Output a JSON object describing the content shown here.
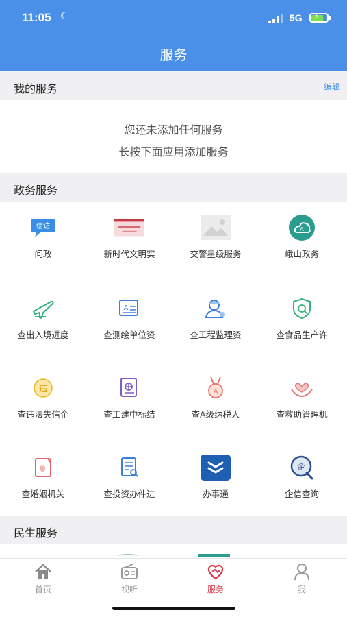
{
  "status_bar": {
    "time": "11:05",
    "network": "5G"
  },
  "header": {
    "title": "服务"
  },
  "my_services": {
    "title": "我的服务",
    "edit_label": "编辑",
    "empty_line1": "您还未添加任何服务",
    "empty_line2": "长按下面应用添加服务"
  },
  "gov_services": {
    "title": "政务服务",
    "items": [
      {
        "label": "问政",
        "icon": "letters-visits-icon"
      },
      {
        "label": "新时代文明实",
        "icon": "civilization-practice-icon"
      },
      {
        "label": "交警星级服务",
        "icon": "image-placeholder-icon"
      },
      {
        "label": "峨山政务",
        "icon": "cloud-gov-icon"
      },
      {
        "label": "查出入境进度",
        "icon": "airplane-icon"
      },
      {
        "label": "查测绘单位资",
        "icon": "surveying-icon"
      },
      {
        "label": "查工程监理资",
        "icon": "engineer-icon"
      },
      {
        "label": "查食品生产许",
        "icon": "food-shield-icon"
      },
      {
        "label": "查违法失信企",
        "icon": "violation-icon"
      },
      {
        "label": "查工建中标结",
        "icon": "bid-result-icon"
      },
      {
        "label": "查A级纳税人",
        "icon": "taxpayer-medal-icon"
      },
      {
        "label": "查救助管理机",
        "icon": "relief-hands-icon"
      },
      {
        "label": "查婚姻机关",
        "icon": "marriage-icon"
      },
      {
        "label": "查投资办件进",
        "icon": "investment-doc-icon"
      },
      {
        "label": "办事通",
        "icon": "banshitong-icon"
      },
      {
        "label": "企信查询",
        "icon": "enterprise-search-icon"
      }
    ]
  },
  "people_services": {
    "title": "民生服务"
  },
  "tabbar": {
    "items": [
      {
        "label": "首页",
        "icon": "home-icon"
      },
      {
        "label": "视听",
        "icon": "radio-icon"
      },
      {
        "label": "服务",
        "icon": "service-heart-icon"
      },
      {
        "label": "我",
        "icon": "person-icon"
      }
    ],
    "active_color": "#d9364a",
    "inactive_color": "#9a9a9a"
  },
  "colors": {
    "brand": "#4a90e8",
    "section_bg": "#f0f0f2"
  }
}
